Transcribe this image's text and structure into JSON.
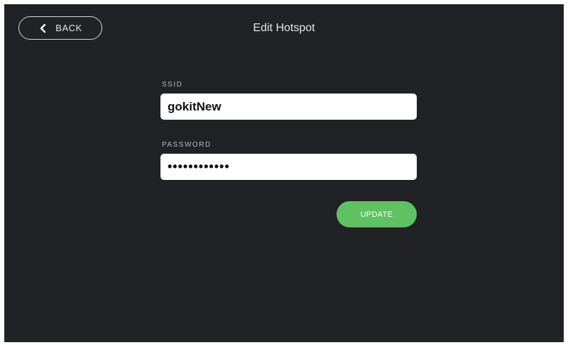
{
  "header": {
    "back_label": "BACK",
    "title": "Edit Hotspot"
  },
  "form": {
    "ssid_label": "SSID",
    "ssid_value": "gokitNew",
    "password_label": "PASSWORD",
    "password_value": "••••••••••••"
  },
  "actions": {
    "update_label": "UPDATE"
  },
  "colors": {
    "background": "#202226",
    "accent": "#5fc262"
  },
  "icons": {
    "back": "chevron-left-icon"
  }
}
